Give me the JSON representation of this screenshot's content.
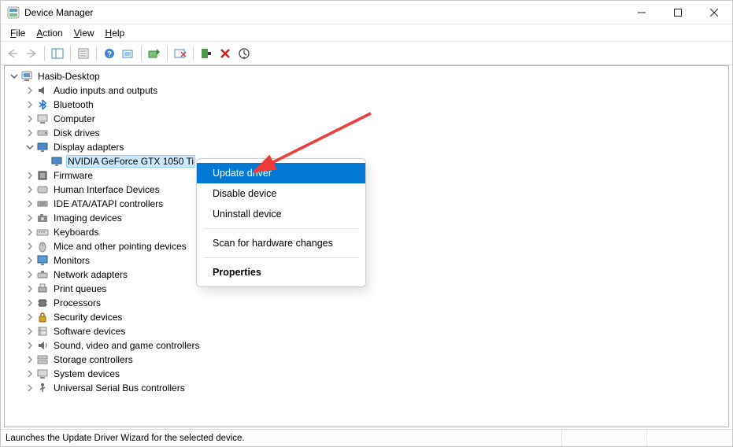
{
  "window": {
    "title": "Device Manager"
  },
  "menubar": {
    "file": "File",
    "action": "Action",
    "view": "View",
    "help": "Help"
  },
  "tree": {
    "root": "Hasib-Desktop",
    "items": [
      "Audio inputs and outputs",
      "Bluetooth",
      "Computer",
      "Disk drives",
      "Display adapters",
      "Firmware",
      "Human Interface Devices",
      "IDE ATA/ATAPI controllers",
      "Imaging devices",
      "Keyboards",
      "Mice and other pointing devices",
      "Monitors",
      "Network adapters",
      "Print queues",
      "Processors",
      "Security devices",
      "Software devices",
      "Sound, video and game controllers",
      "Storage controllers",
      "System devices",
      "Universal Serial Bus controllers"
    ],
    "display_child": "NVIDIA GeForce GTX 1050 Ti"
  },
  "contextmenu": {
    "update": "Update driver",
    "disable": "Disable device",
    "uninstall": "Uninstall device",
    "scan": "Scan for hardware changes",
    "properties": "Properties"
  },
  "statusbar": {
    "text": "Launches the Update Driver Wizard for the selected device."
  }
}
